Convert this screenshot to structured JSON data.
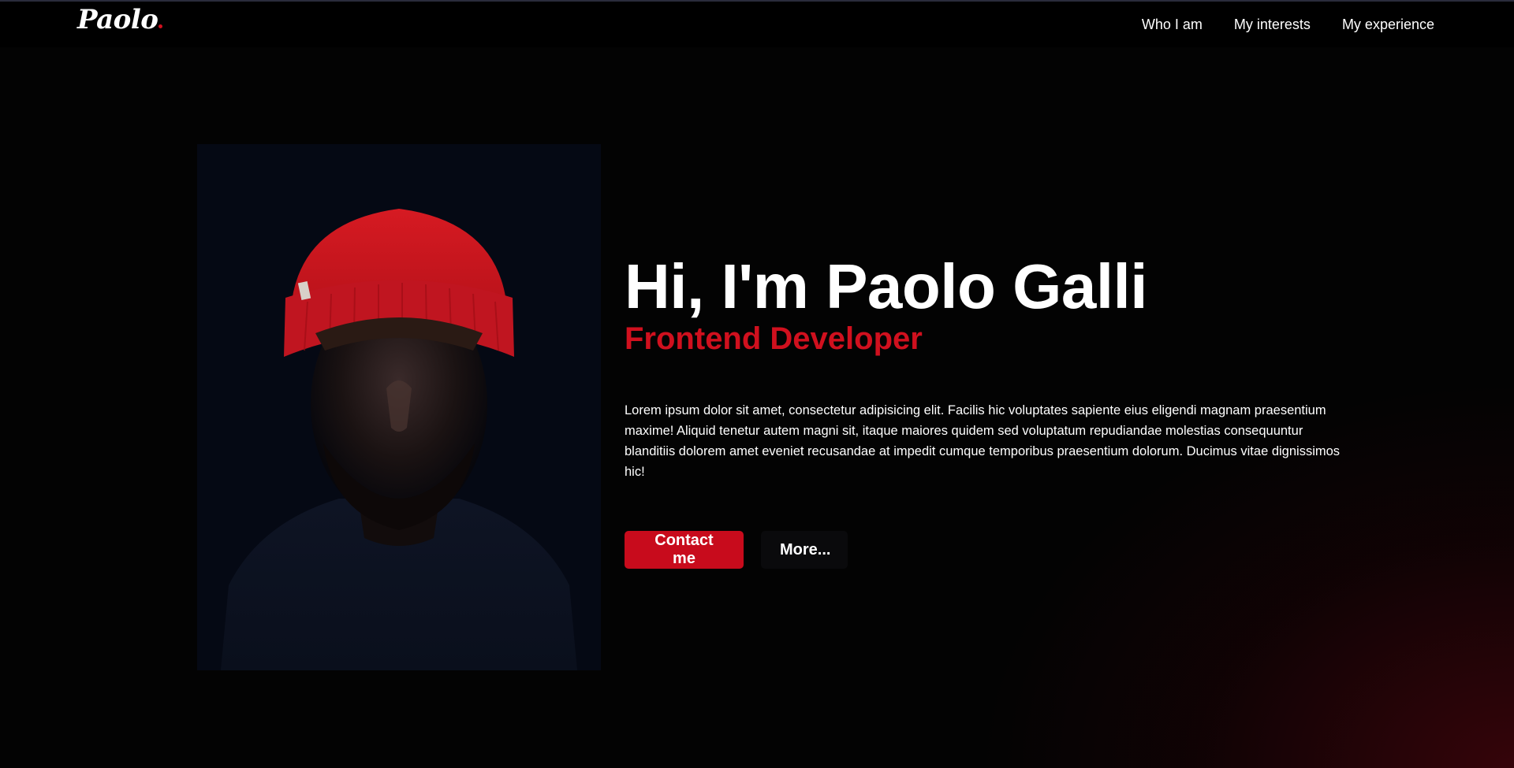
{
  "navbar": {
    "logo": "Paolo",
    "links": [
      "Who I am",
      "My interests",
      "My experience"
    ]
  },
  "hero": {
    "headline": "Hi, I'm Paolo Galli",
    "subheadline": "Frontend Developer",
    "bio": "Lorem ipsum dolor sit amet, consectetur adipisicing elit. Facilis hic voluptates sapiente eius eligendi magnam praesentium maxime! Aliquid tenetur autem magni sit, itaque maiores quidem sed voluptatum repudiandae molestias consequuntur blanditiis dolorem amet eveniet recusandae at impedit cumque temporibus praesentium dolorum. Ducimus vitae dignissimos hic!",
    "primary_button": "Contact me",
    "secondary_button": "More..."
  },
  "colors": {
    "accent": "#d0101e",
    "button_primary": "#c80b1c",
    "background": "#030303"
  },
  "icons": {
    "portrait": "portrait-photo-red-beanie"
  }
}
